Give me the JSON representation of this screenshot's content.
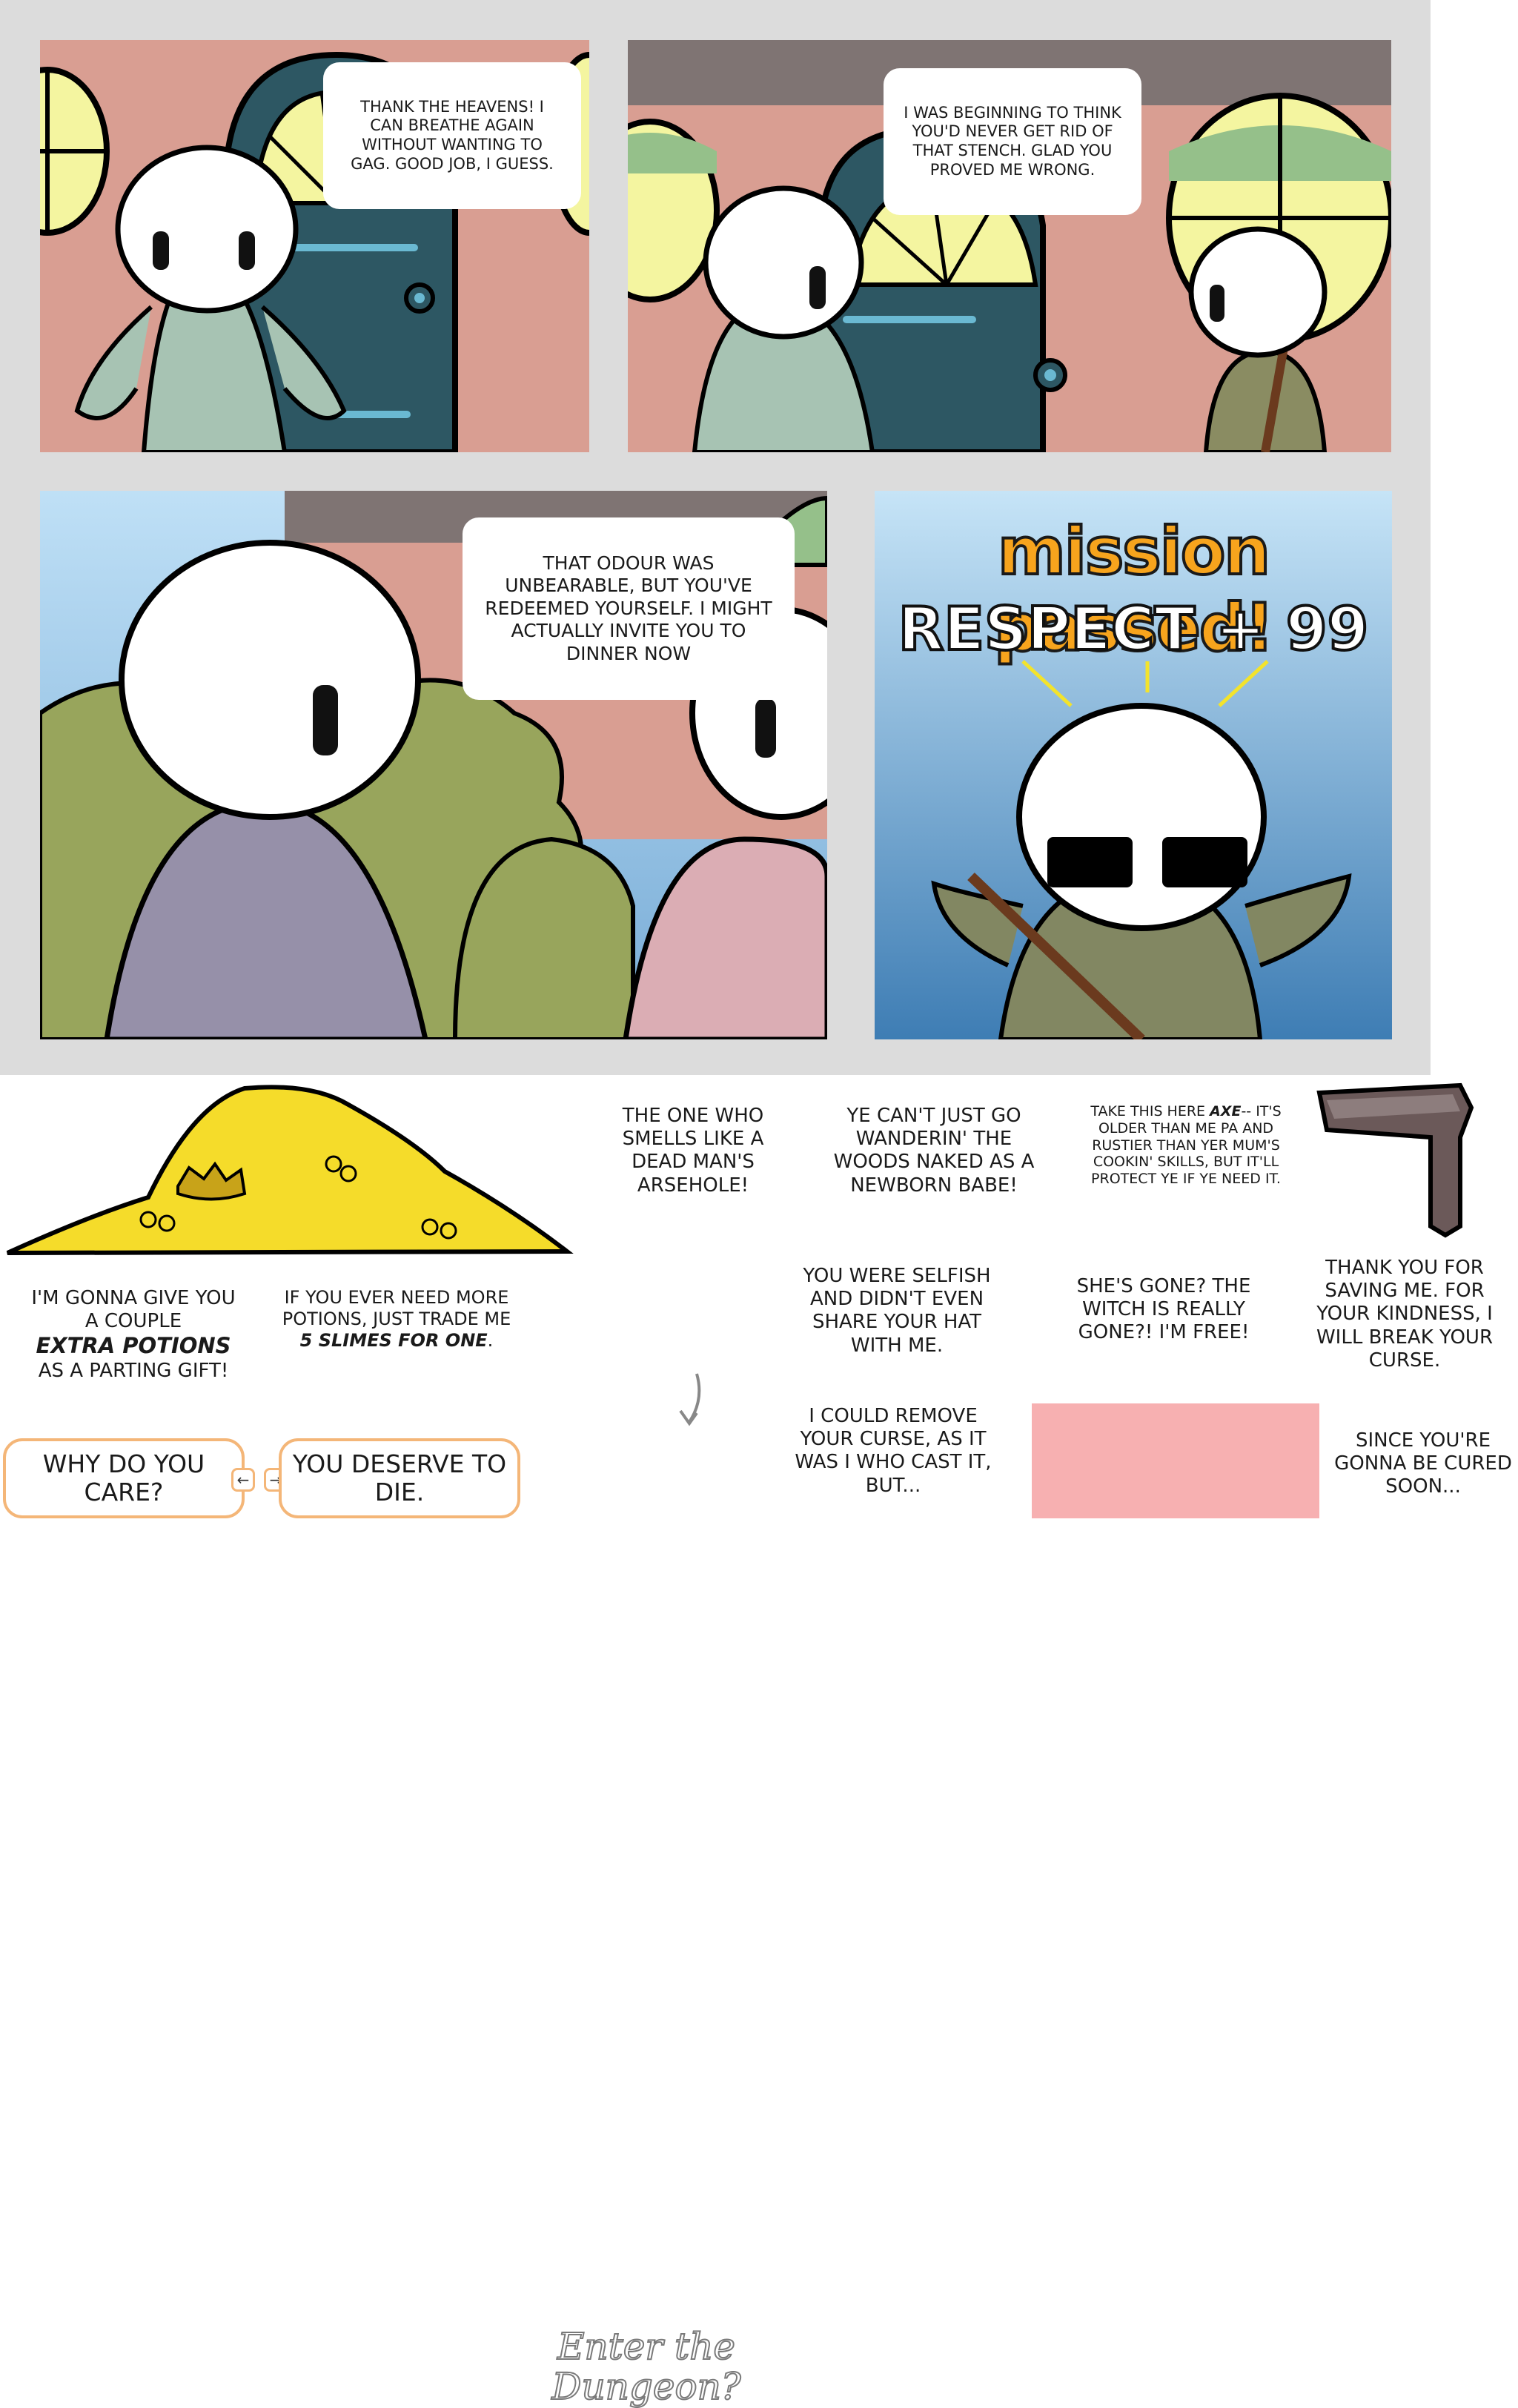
{
  "panels": {
    "p1": {
      "bubble": "THANK THE HEAVENS! I CAN BREATHE AGAIN WITHOUT WANTING TO GAG. GOOD JOB, I GUESS."
    },
    "p2": {
      "bubble": "I WAS BEGINNING TO THINK YOU'D NEVER GET RID OF THAT STENCH. GLAD YOU PROVED ME WRONG."
    },
    "p3": {
      "bubble": "THAT ODOUR WAS UNBEARABLE, BUT YOU'VE REDEEMED YOURSELF. I MIGHT ACTUALLY INVITE YOU TO DINNER NOW"
    },
    "p4": {
      "title": "mission passed!",
      "respect": "RESPECT + 99"
    }
  },
  "sheet": {
    "dialogue_1": "THE ONE WHO SMELLS LIKE A DEAD MAN'S ARSEHOLE!",
    "dialogue_2": "YE CAN'T JUST GO WANDERIN' THE WOODS NAKED AS A NEWBORN BABE!",
    "dialogue_3_pre": "TAKE THIS HERE ",
    "dialogue_3_em": "AXE",
    "dialogue_3_post": "-- IT'S OLDER THAN ME PA AND RUSTIER THAN YER MUM'S COOKIN' SKILLS, BUT IT'LL PROTECT YE IF YE NEED IT.",
    "potions_pre": "I'M GONNA GIVE YOU A COUPLE",
    "potions_em": "EXTRA POTIONS",
    "potions_post": "AS A PARTING GIFT!",
    "trade_pre": "IF YOU EVER NEED MORE POTIONS, JUST TRADE ME",
    "trade_em": "5 SLIMES FOR ONE",
    "trade_post": ".",
    "enter_dungeon": "Enter the Dungeon?",
    "selfish": "YOU WERE SELFISH AND DIDN'T EVEN SHARE YOUR HAT WITH ME.",
    "witch_gone": "SHE'S GONE? THE WITCH IS REALLY GONE?! I'M FREE!",
    "thank_you": "THANK YOU FOR SAVING ME. FOR YOUR KINDNESS, I WILL BREAK YOUR CURSE.",
    "remove_curse": "I COULD REMOVE YOUR CURSE, AS IT WAS I WHO CAST IT, BUT...",
    "cured_soon": "SINCE YOU'RE GONNA BE CURED SOON..."
  },
  "choices": {
    "left": "WHY DO YOU CARE?",
    "right": "YOU DESERVE TO DIE.",
    "arrow_left": "←",
    "arrow_right": "→"
  },
  "colors": {
    "gutter": "#dcdcdc",
    "wall": "#d9a093",
    "door": "#2d5763",
    "window": "#f4f5a0",
    "swatch": "#f7b0b1",
    "gold": "#f5dc2a",
    "accent_orange": "#f7a41d"
  }
}
